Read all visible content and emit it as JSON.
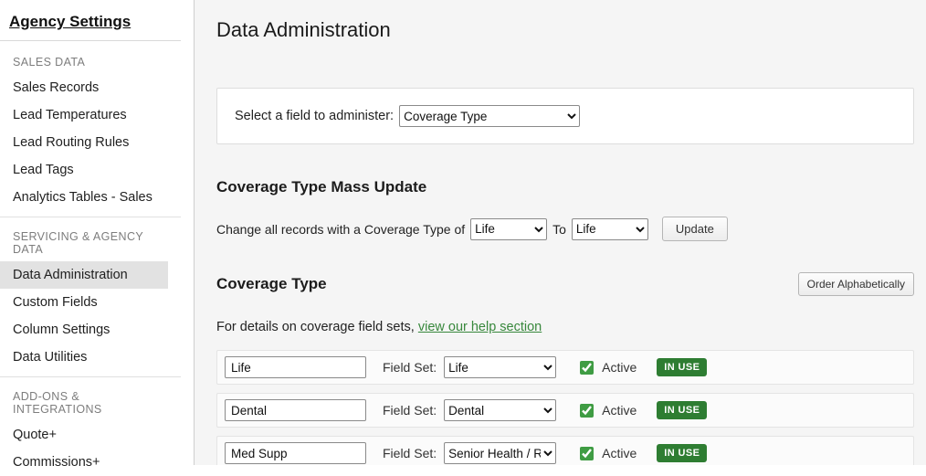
{
  "sidebar": {
    "title": "Agency Settings",
    "sections": [
      {
        "header": "SALES DATA",
        "items": [
          "Sales Records",
          "Lead Temperatures",
          "Lead Routing Rules",
          "Lead Tags",
          "Analytics Tables - Sales"
        ]
      },
      {
        "header": "SERVICING & AGENCY DATA",
        "items": [
          "Data Administration",
          "Custom Fields",
          "Column Settings",
          "Data Utilities"
        ]
      },
      {
        "header": "ADD-ONS & INTEGRATIONS",
        "items": [
          "Quote+",
          "Commissions+"
        ]
      }
    ],
    "selected_item": "Data Administration"
  },
  "main": {
    "title": "Data Administration",
    "field_selector": {
      "label": "Select a field to administer:",
      "value": "Coverage Type"
    },
    "mass_update": {
      "heading": "Coverage Type Mass Update",
      "text_before": "Change all records with a Coverage Type of",
      "from_value": "Life",
      "to_label": "To",
      "to_value": "Life",
      "update_button": "Update"
    },
    "coverage": {
      "heading": "Coverage Type",
      "order_button": "Order Alphabetically",
      "help_text": "For details on coverage field sets,",
      "help_link": "view our help section",
      "rows": [
        {
          "name": "Life",
          "field_set_label": "Field Set:",
          "field_set": "Life",
          "active_label": "Active",
          "badge": "IN USE"
        },
        {
          "name": "Dental",
          "field_set_label": "Field Set:",
          "field_set": "Dental",
          "active_label": "Active",
          "badge": "IN USE"
        },
        {
          "name": "Med Supp",
          "field_set_label": "Field Set:",
          "field_set": "Senior Health / RX",
          "active_label": "Active",
          "badge": "IN USE"
        }
      ]
    }
  },
  "colors": {
    "accent_green": "#2e7d32",
    "link_green": "#38883c",
    "checkbox_green": "#3f9c43",
    "selected_sidebar_bg": "#e2e2e2",
    "main_bg": "#f5f5f5"
  }
}
